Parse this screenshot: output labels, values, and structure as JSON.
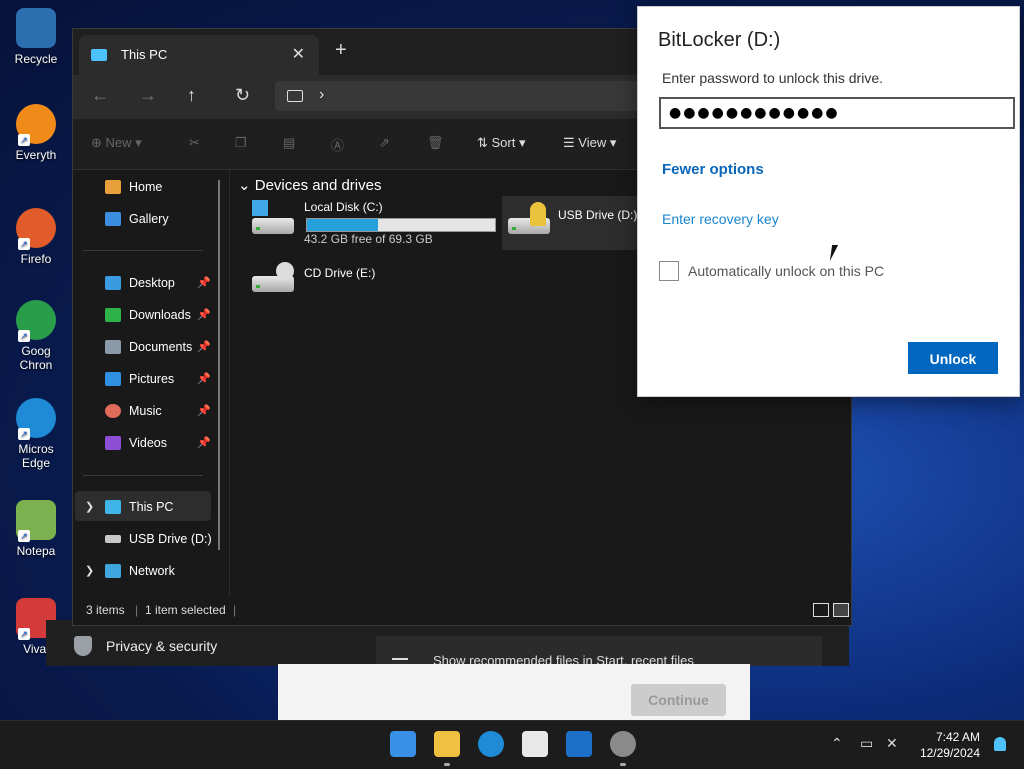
{
  "desktop": {
    "icons": [
      {
        "label": "Recycle",
        "color": "#2c6fb0",
        "shortcut": false
      },
      {
        "label": "Everyth",
        "color": "#f08a18",
        "shortcut": true
      },
      {
        "label": "Firefo",
        "color": "#e25b2b",
        "shortcut": true
      },
      {
        "label": "Goog Chron",
        "color": "#2a9d4a",
        "shortcut": true
      },
      {
        "label": "Micros Edge",
        "color": "#1f8ad6",
        "shortcut": true
      },
      {
        "label": "Notepa",
        "color": "#7db04f",
        "shortcut": true
      },
      {
        "label": "Vival",
        "color": "#d33a3a",
        "shortcut": true
      }
    ]
  },
  "settings_bg": {
    "privacy_label": "Privacy & security",
    "recommend_text": "Show recommended files in Start, recent files",
    "continue_label": "Continue"
  },
  "explorer": {
    "tab_title": "This PC",
    "new_tab_glyph": "+",
    "toolbar": {
      "new": "New",
      "sort": "Sort",
      "view": "View"
    },
    "nav": {
      "home": "Home",
      "gallery": "Gallery",
      "desktop": "Desktop",
      "downloads": "Downloads",
      "documents": "Documents",
      "pictures": "Pictures",
      "music": "Music",
      "videos": "Videos",
      "this_pc": "This PC",
      "usb": "USB Drive (D:)",
      "network": "Network"
    },
    "group_header": "Devices and drives",
    "drives": {
      "c_name": "Local Disk (C:)",
      "c_free": "43.2 GB free of 69.3 GB",
      "c_used_fraction": 0.377,
      "d_name": "USB Drive (D:)",
      "e_name": "CD Drive (E:)"
    },
    "status": {
      "items": "3 items",
      "selected": "1 item selected"
    }
  },
  "bitlocker": {
    "title": "BitLocker (D:)",
    "prompt": "Enter password to unlock this drive.",
    "password_masked": "●●●●●●●●●●●●",
    "fewer_options": "Fewer options",
    "recovery_key": "Enter recovery key",
    "auto_unlock": "Automatically unlock on this PC",
    "unlock_button": "Unlock"
  },
  "taskbar": {
    "time": "7:42 AM",
    "date": "12/29/2024",
    "accent": "#4cc2ff"
  }
}
